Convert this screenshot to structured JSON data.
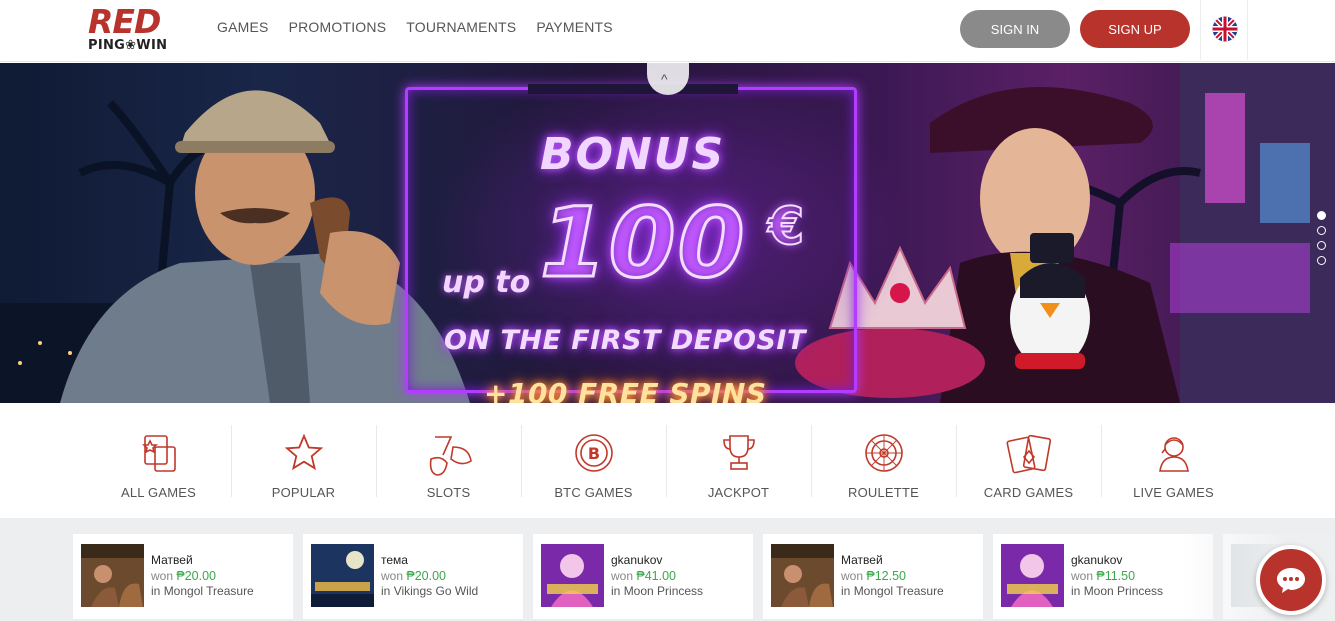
{
  "header": {
    "logo_main": "RED",
    "logo_sub": "PING❀WIN",
    "nav": [
      "GAMES",
      "PROMOTIONS",
      "TOURNAMENTS",
      "PAYMENTS"
    ],
    "signin_label": "SIGN IN",
    "signup_label": "SIGN UP",
    "language_icon": "uk-flag-icon"
  },
  "banner": {
    "line_bonus": "BONUS",
    "line_upto": "up to",
    "line_amount": "100",
    "line_currency": "€",
    "line_deposit": "ON THE FIRST DEPOSIT",
    "line_spins": "+100 FREE SPINS",
    "collapse_icon": "^",
    "slides": [
      true,
      false,
      false,
      false
    ]
  },
  "categories": [
    {
      "label": "ALL GAMES",
      "icon": "cards-stars-icon"
    },
    {
      "label": "POPULAR",
      "icon": "star-icon"
    },
    {
      "label": "SLOTS",
      "icon": "fruits-icon"
    },
    {
      "label": "BTC GAMES",
      "icon": "bitcoin-icon"
    },
    {
      "label": "JACKPOT",
      "icon": "trophy-icon"
    },
    {
      "label": "ROULETTE",
      "icon": "roulette-icon"
    },
    {
      "label": "CARD GAMES",
      "icon": "playing-cards-icon"
    },
    {
      "label": "LIVE GAMES",
      "icon": "live-dealer-icon"
    }
  ],
  "winners": [
    {
      "name": "Матвей",
      "won_prefix": "won",
      "amount": "₱20.00",
      "in_prefix": "in",
      "game": "Mongol Treasure",
      "thumb": "mongol-treasure-thumb"
    },
    {
      "name": "тема",
      "won_prefix": "won",
      "amount": "₱20.00",
      "in_prefix": "in",
      "game": "Vikings Go Wild",
      "thumb": "vikings-go-wild-thumb"
    },
    {
      "name": "gkanukov",
      "won_prefix": "won",
      "amount": "₱41.00",
      "in_prefix": "in",
      "game": "Moon Princess",
      "thumb": "moon-princess-thumb"
    },
    {
      "name": "Матвей",
      "won_prefix": "won",
      "amount": "₱12.50",
      "in_prefix": "in",
      "game": "Mongol Treasure",
      "thumb": "mongol-treasure-thumb"
    },
    {
      "name": "gkanukov",
      "won_prefix": "won",
      "amount": "₱11.50",
      "in_prefix": "in",
      "game": "Moon Princess",
      "thumb": "moon-princess-thumb"
    }
  ],
  "chat": {
    "icon": "chat-bubble-icon"
  },
  "colors": {
    "brand": "#b8332b",
    "signin": "#8a8a8a",
    "won": "#3aa84a",
    "neon": "#b23cff"
  }
}
